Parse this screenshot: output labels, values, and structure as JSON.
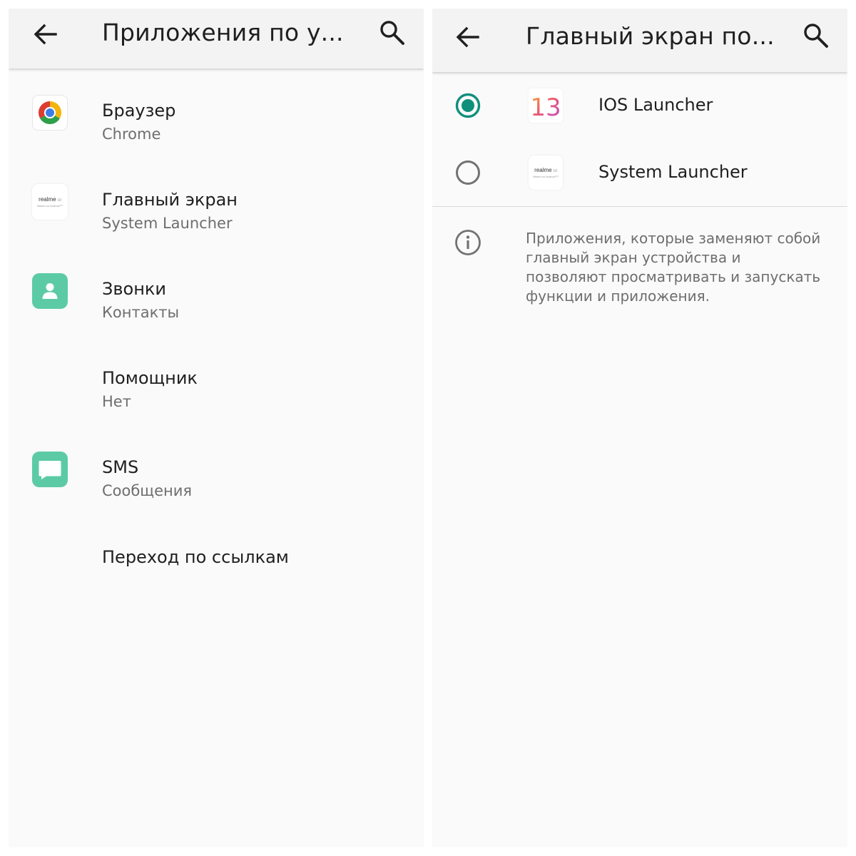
{
  "left_screen": {
    "title": "Приложения по у...",
    "items": [
      {
        "title": "Браузер",
        "subtitle": "Chrome",
        "icon": "chrome-icon"
      },
      {
        "title": "Главный экран",
        "subtitle": "System Launcher",
        "icon": "realme-ui-icon"
      },
      {
        "title": "Звонки",
        "subtitle": "Контакты",
        "icon": "contacts-icon"
      },
      {
        "title": "Помощник",
        "subtitle": "Нет",
        "icon": ""
      },
      {
        "title": "SMS",
        "subtitle": "Сообщения",
        "icon": "messages-icon"
      },
      {
        "title": "Переход по ссылкам",
        "subtitle": "",
        "icon": ""
      }
    ]
  },
  "right_screen": {
    "title": "Главный экран по...",
    "launchers": [
      {
        "label": "IOS Launcher",
        "icon_text": "13",
        "selected": true,
        "icon": "ios13-icon"
      },
      {
        "label": "System Launcher",
        "selected": false,
        "icon": "realme-ui-icon"
      }
    ],
    "info": "Приложения, которые заменяют собой главный экран устройства и позволяют просматривать и запускать функции и приложения."
  },
  "realme_icon": {
    "brand": "realme",
    "suffix": "UI",
    "small": "Based on Android™"
  },
  "colors": {
    "accent": "#0f8f7c",
    "contacts_green": "#5ccba5",
    "text_primary": "#1f1f1f",
    "text_secondary": "#6e6e6e",
    "background": "#fafafa"
  }
}
